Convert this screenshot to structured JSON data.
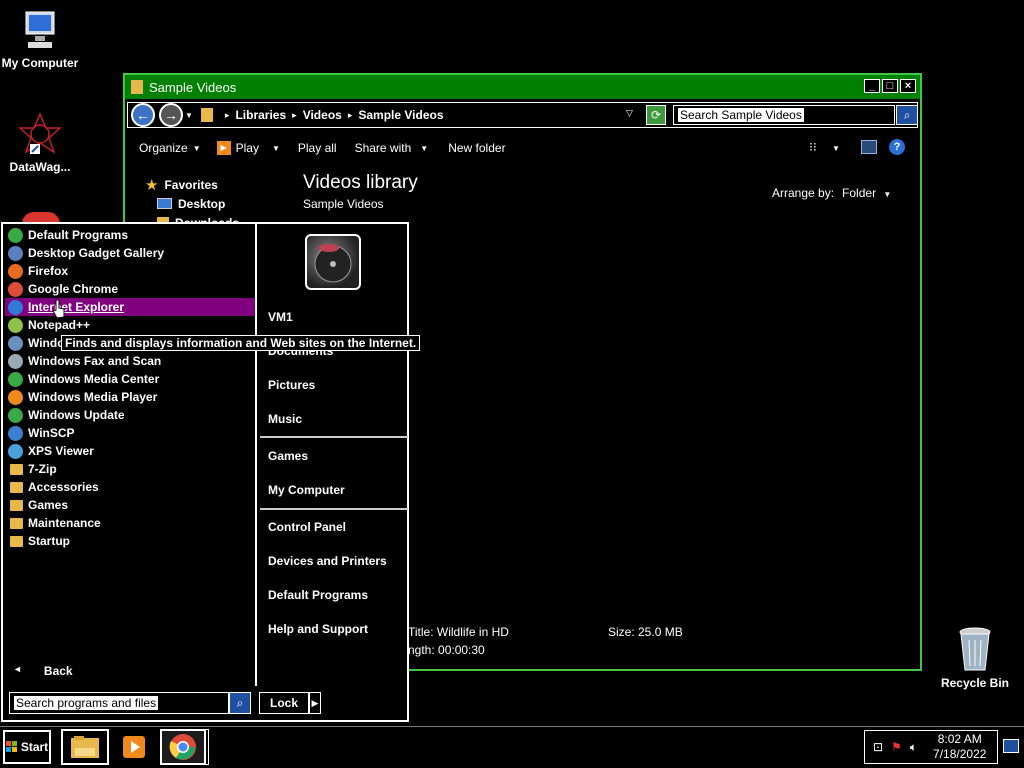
{
  "desktop": {
    "icons": [
      {
        "label": "My Computer",
        "icon": "computer-icon"
      },
      {
        "label": "DataWag...",
        "icon": "datawag-icon"
      },
      {
        "label": "Recycle Bin",
        "icon": "recycle-bin-icon"
      }
    ]
  },
  "explorer": {
    "title": "Sample Videos",
    "breadcrumb": [
      "Libraries",
      "Videos",
      "Sample Videos"
    ],
    "search_text": "Search Sample Videos",
    "toolbar": {
      "organize": "Organize",
      "play": "Play",
      "play_all": "Play all",
      "share_with": "Share with",
      "new_folder": "New folder"
    },
    "nav": {
      "favorites": "Favorites",
      "desktop": "Desktop",
      "downloads": "Downloads"
    },
    "library_title": "Videos library",
    "library_subtitle": "Sample Videos",
    "arrange_by_label": "Arrange by:",
    "arrange_by_value": "Folder",
    "details": {
      "title": "Title: Wildlife in HD",
      "length": "ngth: 00:00:30",
      "size": "Size: 25.0 MB"
    }
  },
  "start_menu": {
    "programs": [
      {
        "label": "Default Programs",
        "icon": "default-programs-icon",
        "color": "#3aa845"
      },
      {
        "label": "Desktop Gadget Gallery",
        "icon": "gadget-gallery-icon",
        "color": "#5b7fbf"
      },
      {
        "label": "Firefox",
        "icon": "firefox-icon",
        "color": "#e66b1f"
      },
      {
        "label": "Google Chrome",
        "icon": "chrome-icon",
        "color": "#dd4b39"
      },
      {
        "label": "Internet Explorer",
        "icon": "internet-explorer-icon",
        "color": "#2f7ad6"
      },
      {
        "label": "Notepad++",
        "icon": "notepad-plus-plus-icon",
        "color": "#8fc04a"
      },
      {
        "label": "Windows DVD Maker",
        "icon": "dvd-maker-icon",
        "color": "#6a90c0"
      },
      {
        "label": "Windows Fax and Scan",
        "icon": "fax-scan-icon",
        "color": "#9aa9b5"
      },
      {
        "label": "Windows Media Center",
        "icon": "media-center-icon",
        "color": "#3aa845"
      },
      {
        "label": "Windows Media Player",
        "icon": "media-player-icon",
        "color": "#f08a1c"
      },
      {
        "label": "Windows Update",
        "icon": "windows-update-icon",
        "color": "#3aa845"
      },
      {
        "label": "WinSCP",
        "icon": "winscp-icon",
        "color": "#3b7fd0"
      },
      {
        "label": "XPS Viewer",
        "icon": "xps-viewer-icon",
        "color": "#4aa0d8"
      },
      {
        "label": "7-Zip",
        "icon": "folder-icon",
        "color": "#e8b84a"
      },
      {
        "label": "Accessories",
        "icon": "folder-icon",
        "color": "#e8b84a"
      },
      {
        "label": "Games",
        "icon": "folder-icon",
        "color": "#e8b84a"
      },
      {
        "label": "Maintenance",
        "icon": "folder-icon",
        "color": "#e8b84a"
      },
      {
        "label": "Startup",
        "icon": "folder-icon",
        "color": "#e8b84a"
      }
    ],
    "selected_index": 4,
    "back_label": "Back",
    "search_text": "Search programs and files",
    "right_items": {
      "user": "VM1",
      "documents": "Documents",
      "pictures": "Pictures",
      "music": "Music",
      "games": "Games",
      "my_computer": "My Computer",
      "control_panel": "Control Panel",
      "devices_printers": "Devices and Printers",
      "default_programs": "Default Programs",
      "help_support": "Help and Support"
    },
    "lock_label": "Lock",
    "tooltip": "Finds and displays information and Web sites on the Internet."
  },
  "taskbar": {
    "start_label": "Start",
    "time": "8:02 AM",
    "date": "7/18/2022"
  }
}
